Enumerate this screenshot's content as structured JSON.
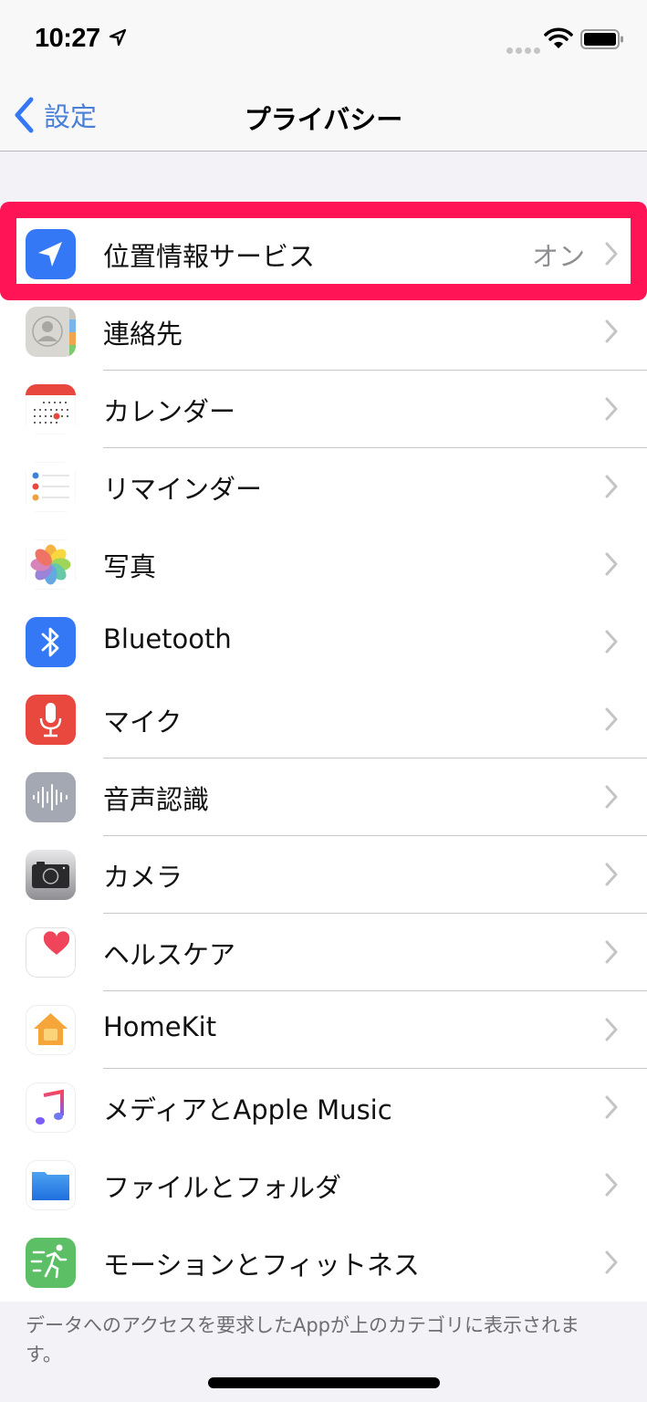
{
  "status_bar": {
    "time": "10:27",
    "location_icon": "location-arrow-icon",
    "signal_icon": "cellular-dots-icon",
    "wifi_icon": "wifi-icon",
    "battery_icon": "battery-full-icon"
  },
  "nav": {
    "back_label": "設定",
    "back_icon": "chevron-left-icon",
    "title": "プライバシー"
  },
  "colors": {
    "accent": "#3478f6",
    "highlight": "#ff1455",
    "secondary_text": "#8e8e93",
    "background": "#f2f2f7"
  },
  "items": [
    {
      "label": "位置情報サービス",
      "value": "オン",
      "icon": "location-services-icon",
      "separator": false,
      "highlighted": true
    },
    {
      "label": "連絡先",
      "value": "",
      "icon": "contacts-icon",
      "separator": true,
      "highlighted": false
    },
    {
      "label": "カレンダー",
      "value": "",
      "icon": "calendar-icon",
      "separator": true,
      "highlighted": false
    },
    {
      "label": "リマインダー",
      "value": "",
      "icon": "reminders-icon",
      "separator": false,
      "highlighted": false
    },
    {
      "label": "写真",
      "value": "",
      "icon": "photos-icon",
      "separator": false,
      "highlighted": false
    },
    {
      "label": "Bluetooth",
      "value": "",
      "icon": "bluetooth-icon",
      "separator": false,
      "highlighted": false
    },
    {
      "label": "マイク",
      "value": "",
      "icon": "microphone-icon",
      "separator": true,
      "highlighted": false
    },
    {
      "label": "音声認識",
      "value": "",
      "icon": "speech-recognition-icon",
      "separator": true,
      "highlighted": false
    },
    {
      "label": "カメラ",
      "value": "",
      "icon": "camera-icon",
      "separator": true,
      "highlighted": false
    },
    {
      "label": "ヘルスケア",
      "value": "",
      "icon": "health-icon",
      "separator": true,
      "highlighted": false
    },
    {
      "label": "HomeKit",
      "value": "",
      "icon": "homekit-icon",
      "separator": true,
      "highlighted": false
    },
    {
      "label": "メディアとApple Music",
      "value": "",
      "icon": "apple-music-icon",
      "separator": false,
      "highlighted": false
    },
    {
      "label": "ファイルとフォルダ",
      "value": "",
      "icon": "files-icon",
      "separator": false,
      "highlighted": false
    },
    {
      "label": "モーションとフィットネス",
      "value": "",
      "icon": "motion-fitness-icon",
      "separator": false,
      "highlighted": false
    }
  ],
  "footer": {
    "note": "データへのアクセスを要求したAppが上のカテゴリに表示されます。"
  }
}
